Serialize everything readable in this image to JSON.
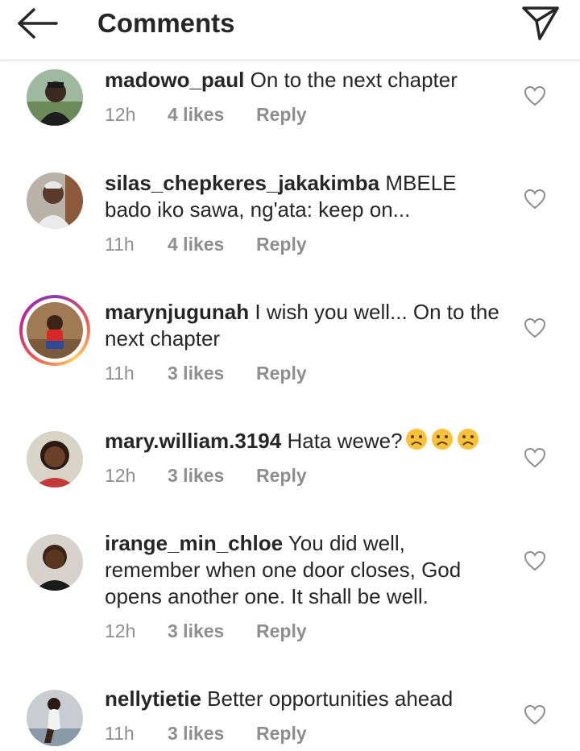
{
  "header": {
    "title": "Comments",
    "back_icon": "arrow-left-icon",
    "send_icon": "paper-plane-icon"
  },
  "colors": {
    "text": "#262626",
    "meta": "#8e8e8e",
    "divider": "#dbdbdb"
  },
  "comments": [
    {
      "username": "madowo_paul",
      "text": "On to the next chapter",
      "time": "12h",
      "likes": "4 likes",
      "reply": "Reply"
    },
    {
      "username": "silas_chepkeres_jakakimba",
      "text": "MBELE bado iko sawa, ng'ata: keep on...",
      "time": "11h",
      "likes": "4 likes",
      "reply": "Reply"
    },
    {
      "username": "marynjugunah",
      "text": "I wish you well... On to the next chapter",
      "time": "11h",
      "likes": "3 likes",
      "reply": "Reply",
      "has_story": true
    },
    {
      "username": "mary.william.3194",
      "text": "Hata wewe?",
      "emoji": [
        "frowning-face-emoji",
        "frowning-face-emoji",
        "frowning-face-emoji"
      ],
      "time": "12h",
      "likes": "3 likes",
      "reply": "Reply"
    },
    {
      "username": "irange_min_chloe",
      "text": "You did well, remember when one door closes, God opens another one. It shall be well.",
      "time": "12h",
      "likes": "3 likes",
      "reply": "Reply"
    },
    {
      "username": "nellytietie",
      "text": "Better opportunities ahead",
      "time": "11h",
      "likes": "3 likes",
      "reply": "Reply"
    }
  ]
}
